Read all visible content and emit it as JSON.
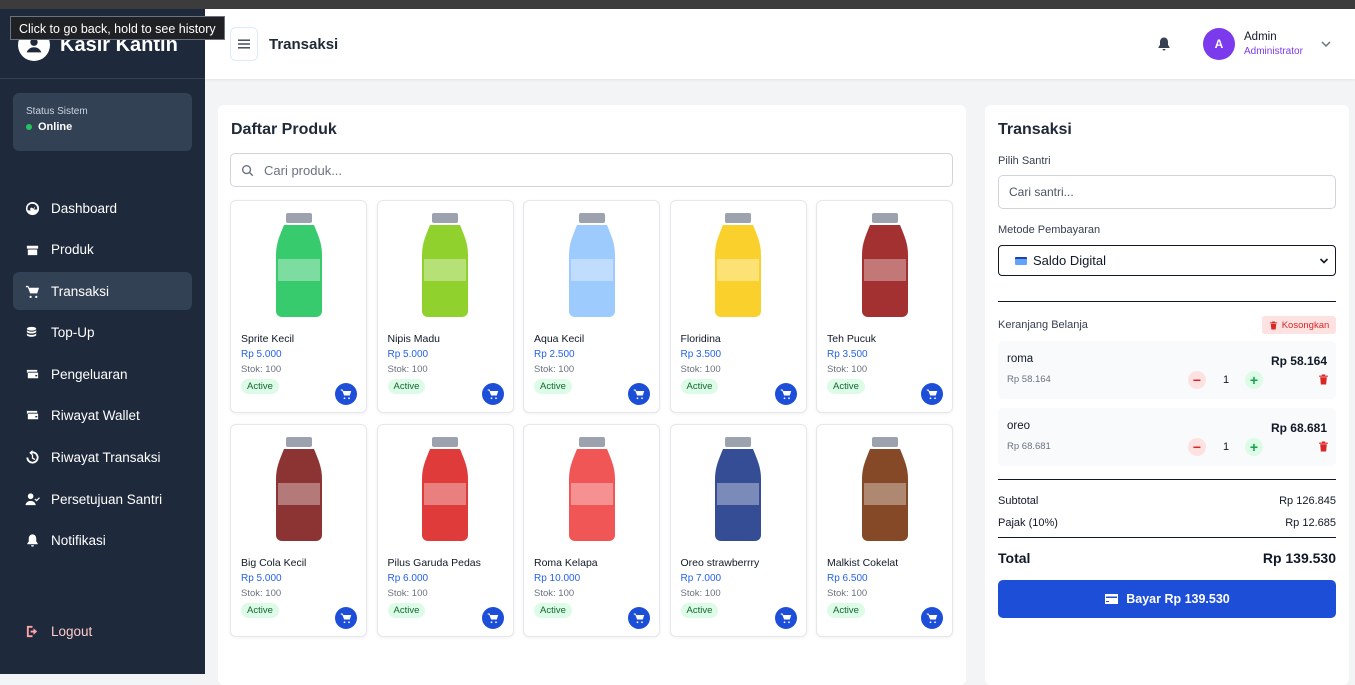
{
  "browser": {
    "tooltip": "Click to go back, hold to see history"
  },
  "sidebar": {
    "brand": "Kasir Kantin",
    "status_label": "Status Sistem",
    "status_value": "Online",
    "items": [
      {
        "label": "Dashboard",
        "icon": "gauge-icon"
      },
      {
        "label": "Produk",
        "icon": "box-icon"
      },
      {
        "label": "Transaksi",
        "icon": "cart-icon",
        "active": true
      },
      {
        "label": "Top-Up",
        "icon": "coins-icon"
      },
      {
        "label": "Pengeluaran",
        "icon": "wallet-icon"
      },
      {
        "label": "Riwayat Wallet",
        "icon": "wallet-icon"
      },
      {
        "label": "Riwayat Transaksi",
        "icon": "history-icon"
      },
      {
        "label": "Persetujuan Santri",
        "icon": "user-check-icon"
      },
      {
        "label": "Notifikasi",
        "icon": "bell-icon"
      }
    ],
    "logout": "Logout"
  },
  "header": {
    "title": "Transaksi",
    "user_initial": "A",
    "user_name": "Admin",
    "user_role": "Administrator"
  },
  "products": {
    "title": "Daftar Produk",
    "search_placeholder": "Cari produk...",
    "items": [
      {
        "name": "Sprite Kecil",
        "price": "Rp 5.000",
        "stock": "Stok: 100",
        "status": "Active",
        "color": "#22c55e"
      },
      {
        "name": "Nipis Madu",
        "price": "Rp 5.000",
        "stock": "Stok: 100",
        "status": "Active",
        "color": "#84cc16"
      },
      {
        "name": "Aqua Kecil",
        "price": "Rp 2.500",
        "stock": "Stok: 100",
        "status": "Active",
        "color": "#93c5fd"
      },
      {
        "name": "Floridina",
        "price": "Rp 3.500",
        "stock": "Stok: 100",
        "status": "Active",
        "color": "#facc15"
      },
      {
        "name": "Teh Pucuk",
        "price": "Rp 3.500",
        "stock": "Stok: 100",
        "status": "Active",
        "color": "#991b1b"
      },
      {
        "name": "Big Cola Kecil",
        "price": "Rp 5.000",
        "stock": "Stok: 100",
        "status": "Active",
        "color": "#7f1d1d"
      },
      {
        "name": "Pilus Garuda Pedas",
        "price": "Rp 6.000",
        "stock": "Stok: 100",
        "status": "Active",
        "color": "#dc2626"
      },
      {
        "name": "Roma Kelapa",
        "price": "Rp 10.000",
        "stock": "Stok: 100",
        "status": "Active",
        "color": "#ef4444"
      },
      {
        "name": "Oreo strawberrry",
        "price": "Rp 7.000",
        "stock": "Stok: 100",
        "status": "Active",
        "color": "#1e3a8a"
      },
      {
        "name": "Malkist Cokelat",
        "price": "Rp 6.500",
        "stock": "Stok: 100",
        "status": "Active",
        "color": "#78350f"
      }
    ]
  },
  "transaction": {
    "title": "Transaksi",
    "santri_label": "Pilih Santri",
    "santri_placeholder": "Cari santri...",
    "payment_label": "Metode Pembayaran",
    "payment_value": "Saldo Digital",
    "cart_label": "Keranjang Belanja",
    "clear_label": "Kosongkan",
    "cart": [
      {
        "name": "roma",
        "unit_price": "Rp 58.164",
        "qty": "1",
        "total": "Rp 58.164"
      },
      {
        "name": "oreo",
        "unit_price": "Rp 68.681",
        "qty": "1",
        "total": "Rp 68.681"
      }
    ],
    "subtotal_label": "Subtotal",
    "subtotal_value": "Rp 126.845",
    "tax_label": "Pajak (10%)",
    "tax_value": "Rp 12.685",
    "total_label": "Total",
    "total_value": "Rp 139.530",
    "pay_label": "Bayar  Rp 139.530"
  }
}
